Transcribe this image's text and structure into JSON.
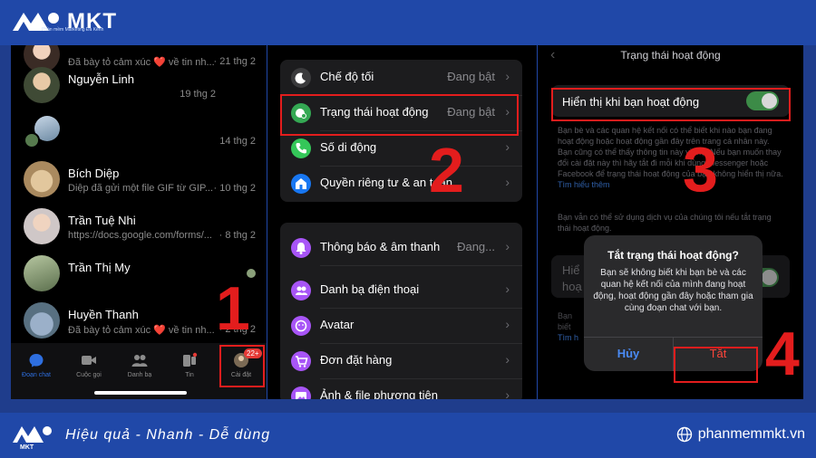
{
  "brand": {
    "name": "MKT",
    "tagline": "Phần mềm Marketing Đa Kênh",
    "slogan": "Hiệu quả - Nhanh  - Dễ dùng",
    "website": "phanmemmkt.vn",
    "colors": {
      "header": "#2048a8",
      "annotation": "#e31d1d"
    }
  },
  "chat_list": {
    "items": [
      {
        "name": "",
        "message": "Đã bày tỏ cảm xúc ",
        "heart": "❤️",
        "message_tail": " về tin nh...",
        "time": "· 21 thg 2"
      },
      {
        "name": "Nguyễn Linh",
        "message": "",
        "time": "19 thg 2"
      },
      {
        "name": "",
        "message": "",
        "time": "14 thg 2"
      },
      {
        "name": "Bích Diệp",
        "message": "Diệp đã gửi một file GIF từ GIP...",
        "time": "· 10 thg 2"
      },
      {
        "name": "Trần Tuệ Nhi",
        "message": "https://docs.google.com/forms/...",
        "time": "· 8 thg 2"
      },
      {
        "name": "Trần Thị My",
        "message": "",
        "time": ""
      },
      {
        "name": "Huyền Thanh",
        "message": "Đã bày tỏ cảm xúc ",
        "heart": "❤️",
        "message_tail": " về tin nh...",
        "time": "· 2 thg 2"
      }
    ],
    "tabs": [
      {
        "label": "Đoạn chat",
        "icon": "chat-bubble-icon",
        "active": true
      },
      {
        "label": "Cuộc gọi",
        "icon": "video-camera-icon"
      },
      {
        "label": "Danh bạ",
        "icon": "people-icon"
      },
      {
        "label": "Tin",
        "icon": "stories-icon"
      },
      {
        "label": "Cài đặt",
        "icon": "profile-avatar-icon",
        "badge": "22+"
      }
    ]
  },
  "settings": {
    "group1": [
      {
        "label": "Chế độ tối",
        "value": "Đang bật",
        "icon": "moon-icon",
        "color": "#3a3a3c"
      },
      {
        "label": "Trạng thái hoạt động",
        "value": "Đang bật",
        "icon": "active-status-icon",
        "color": "#34a853"
      },
      {
        "label": "Số di động",
        "value": "",
        "icon": "phone-icon",
        "color": "#34c759"
      },
      {
        "label": "Quyền riêng tư & an toàn",
        "value": "",
        "icon": "shield-home-icon",
        "color": "#1877f2"
      }
    ],
    "group2": [
      {
        "label": "Thông báo & âm thanh",
        "value": "Đang...",
        "icon": "bell-icon",
        "color": "#a855f7"
      },
      {
        "label": "Danh bạ điện thoại",
        "value": "",
        "icon": "contacts-icon",
        "color": "#a855f7"
      },
      {
        "label": "Avatar",
        "value": "",
        "icon": "avatar-face-icon",
        "color": "#a855f7"
      },
      {
        "label": "Đơn đặt hàng",
        "value": "",
        "icon": "cart-icon",
        "color": "#a855f7"
      },
      {
        "label": "Ảnh & file phương tiện",
        "value": "",
        "icon": "photo-icon",
        "color": "#a855f7"
      }
    ]
  },
  "active_status": {
    "title": "Trạng thái hoạt động",
    "toggle_label": "Hiển thị khi bạn hoạt động",
    "toggle_on": true,
    "description": "Bạn bè và các quan hệ kết nối có thể biết khi nào bạn đang hoạt động hoặc hoạt động gần đây trên trang cá nhân này. Bạn cũng có thể thấy thông tin này về họ. Nếu bạn muốn thay đổi cài đặt này thì hãy tắt đi mỗi khi dùng Messenger hoặc Facebook để trạng thái hoạt động của bạn không hiển thị nữa. ",
    "learn_more": "Tìm hiểu thêm",
    "description2": "Bạn vẫn có thể sử dụng dịch vụ của chúng tôi nếu tắt trạng thái hoạt động.",
    "row2_label_line1": "Hiể",
    "row2_label_line2": "hoạ",
    "desc3_line1": "Bạn",
    "desc3_line2": "biết",
    "desc3_link": "Tìm h"
  },
  "dialog": {
    "title": "Tắt trạng thái hoạt động?",
    "body": "Bạn sẽ không biết khi bạn bè và các quan hệ kết nối của mình đang hoạt động, hoạt động gần đây hoặc tham gia cùng đoạn chat với bạn.",
    "cancel": "Hủy",
    "confirm": "Tắt"
  },
  "steps": [
    "1",
    "2",
    "3",
    "4"
  ]
}
